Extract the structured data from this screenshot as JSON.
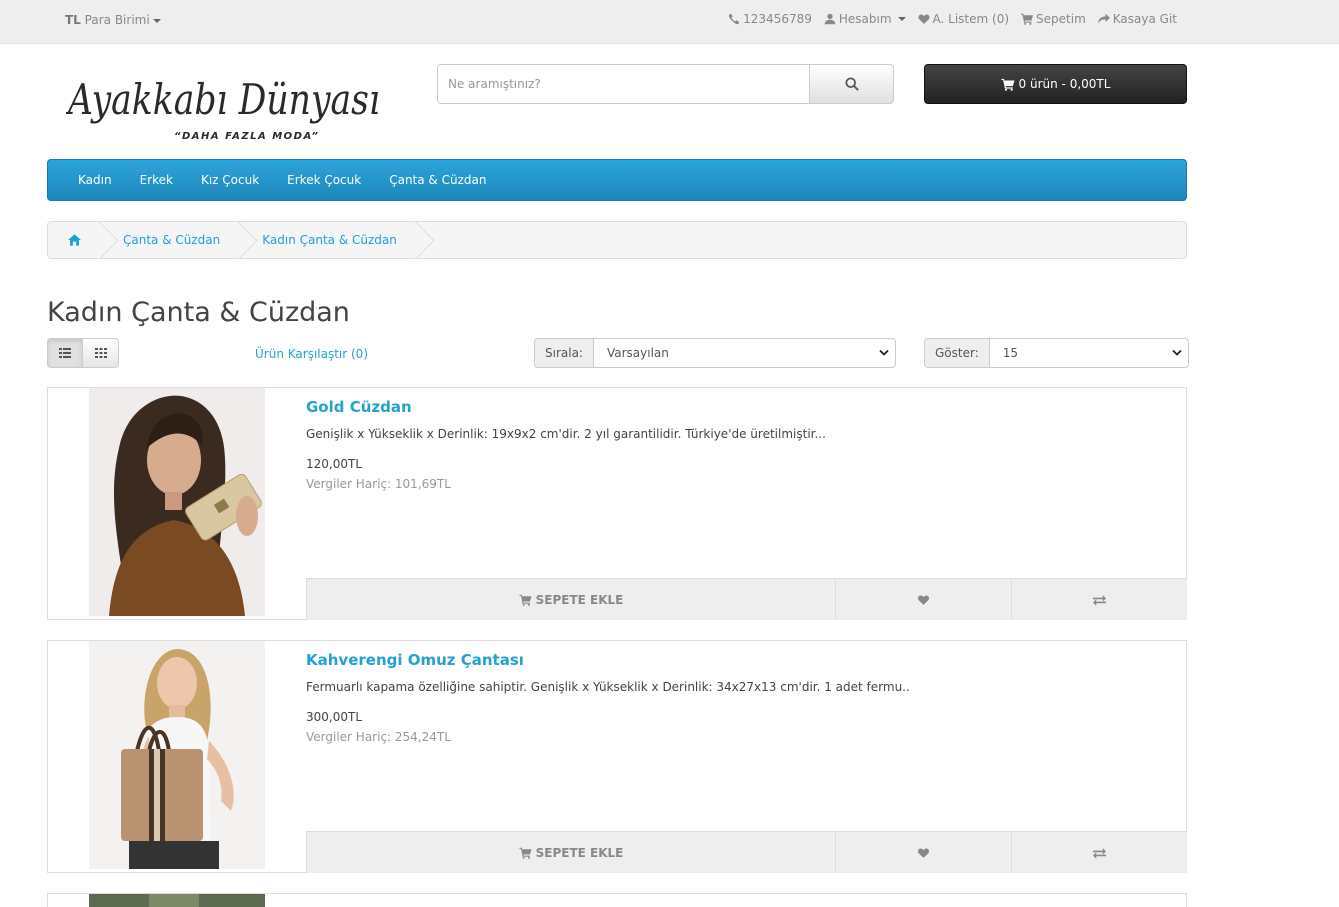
{
  "topbar": {
    "currency_symbol": "TL",
    "currency_label": "Para Birimi",
    "phone": "123456789",
    "account": "Hesabım",
    "wishlist": "A. Listem (0)",
    "cart": "Sepetim",
    "checkout": "Kasaya Git"
  },
  "logo": {
    "text": "Ayakkabı Dünyası",
    "tagline": "“DAHA FAZLA MODA”"
  },
  "search": {
    "placeholder": "Ne aramıştınız?"
  },
  "cart_button": {
    "label": "0 ürün - 0,00TL"
  },
  "nav": {
    "items": [
      "Kadın",
      "Erkek",
      "Kız Çocuk",
      "Erkek Çocuk",
      "Çanta & Cüzdan"
    ]
  },
  "breadcrumb": {
    "items": [
      "Çanta & Cüzdan",
      "Kadın Çanta & Cüzdan"
    ]
  },
  "page": {
    "title": "Kadın Çanta & Cüzdan",
    "compare": "Ürün Karşılaştır (0)",
    "sort_label": "Sırala:",
    "sort_value": "Varsayılan",
    "limit_label": "Göster:",
    "limit_value": "15"
  },
  "products": [
    {
      "name": "Gold Cüzdan",
      "description": "Genişlik x Yükseklik x Derinlik: 19x9x2 cm'dir. 2 yıl garantilidir. Türkiye'de üretilmiştir...",
      "price": "120,00TL",
      "tax": "Vergiler Hariç: 101,69TL",
      "add_to_cart": "SEPETE EKLE"
    },
    {
      "name": "Kahverengi Omuz Çantası",
      "description": "Fermuarlı kapama özelliğine sahiptir. Genişlik x Yükseklik x Derinlik: 34x27x13 cm'dir. 1 adet fermu..",
      "price": "300,00TL",
      "tax": "Vergiler Hariç: 254,24TL",
      "add_to_cart": "SEPETE EKLE"
    }
  ],
  "colors": {
    "accent": "#23a1d1",
    "nav_bg": "#229ad0",
    "cart_bg": "#333333"
  }
}
